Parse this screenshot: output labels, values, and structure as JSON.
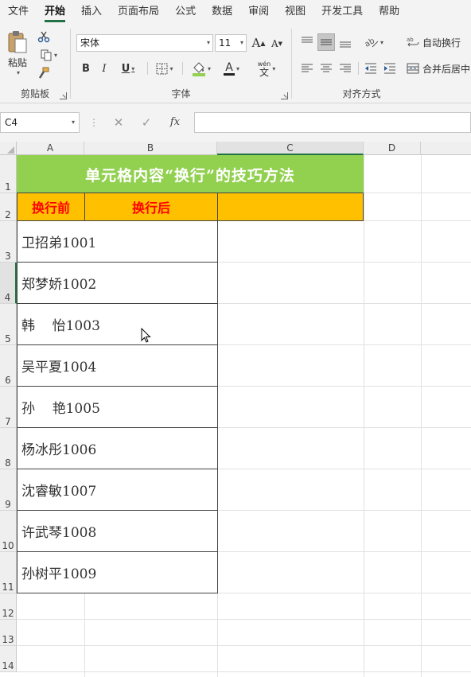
{
  "menu": {
    "tabs": [
      {
        "label": "文件"
      },
      {
        "label": "开始"
      },
      {
        "label": "插入"
      },
      {
        "label": "页面布局"
      },
      {
        "label": "公式"
      },
      {
        "label": "数据"
      },
      {
        "label": "审阅"
      },
      {
        "label": "视图"
      },
      {
        "label": "开发工具"
      },
      {
        "label": "帮助"
      }
    ],
    "active_tab": "开始"
  },
  "ribbon": {
    "clipboard": {
      "paste_label": "粘贴",
      "group_label": "剪贴板"
    },
    "font": {
      "font_name": "宋体",
      "font_size": "11",
      "bold": "B",
      "italic": "I",
      "underline": "U",
      "grow": "A",
      "shrink": "A",
      "font_color": "A",
      "phonetic": "wén",
      "group_label": "字体"
    },
    "alignment": {
      "wrap_text": "自动换行",
      "merge_center": "合并后居中",
      "group_label": "对齐方式"
    }
  },
  "formula_bar": {
    "name_box": "C4",
    "fx_label": "fx",
    "content": ""
  },
  "sheet": {
    "columns": [
      "A",
      "B",
      "C",
      "D"
    ],
    "rows": [
      "1",
      "2",
      "3",
      "4",
      "5",
      "6",
      "7",
      "8",
      "9",
      "10",
      "11",
      "12",
      "13",
      "14"
    ],
    "title": "单元格内容“换行”的技巧方法",
    "header_before": "换行前",
    "header_after": "换行后",
    "names": [
      "卫招弟1001",
      "郑梦娇1002",
      "韩    怡1003",
      "吴平夏1004",
      "孙    艳1005",
      "杨冰彤1006",
      "沈睿敏1007",
      "许武琴1008",
      "孙树平1009"
    ],
    "colors": {
      "title_bg": "#92d050",
      "header_bg": "#ffc000",
      "header_text": "#ff0000",
      "accent": "#217346"
    }
  }
}
